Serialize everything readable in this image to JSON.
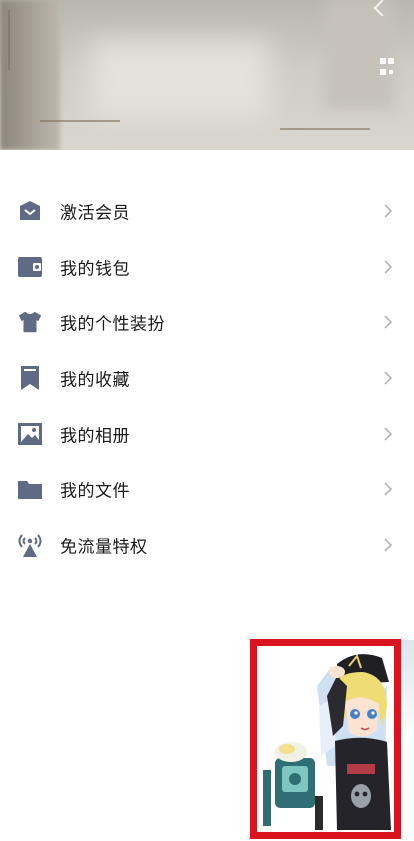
{
  "menu": {
    "items": [
      {
        "label": "激活会员",
        "icon": "vip-crown-icon"
      },
      {
        "label": "我的钱包",
        "icon": "wallet-icon"
      },
      {
        "label": "我的个性装扮",
        "icon": "shirt-icon"
      },
      {
        "label": "我的收藏",
        "icon": "bookmark-icon"
      },
      {
        "label": "我的相册",
        "icon": "album-icon"
      },
      {
        "label": "我的文件",
        "icon": "folder-icon"
      },
      {
        "label": "免流量特权",
        "icon": "signal-tower-icon"
      }
    ]
  },
  "header": {
    "qr_icon": "qr-code-icon"
  },
  "colors": {
    "icon": "#5f6a85",
    "text": "#1a1a1a",
    "chevron": "#b5b5b5",
    "ad_border": "#d9141e"
  }
}
